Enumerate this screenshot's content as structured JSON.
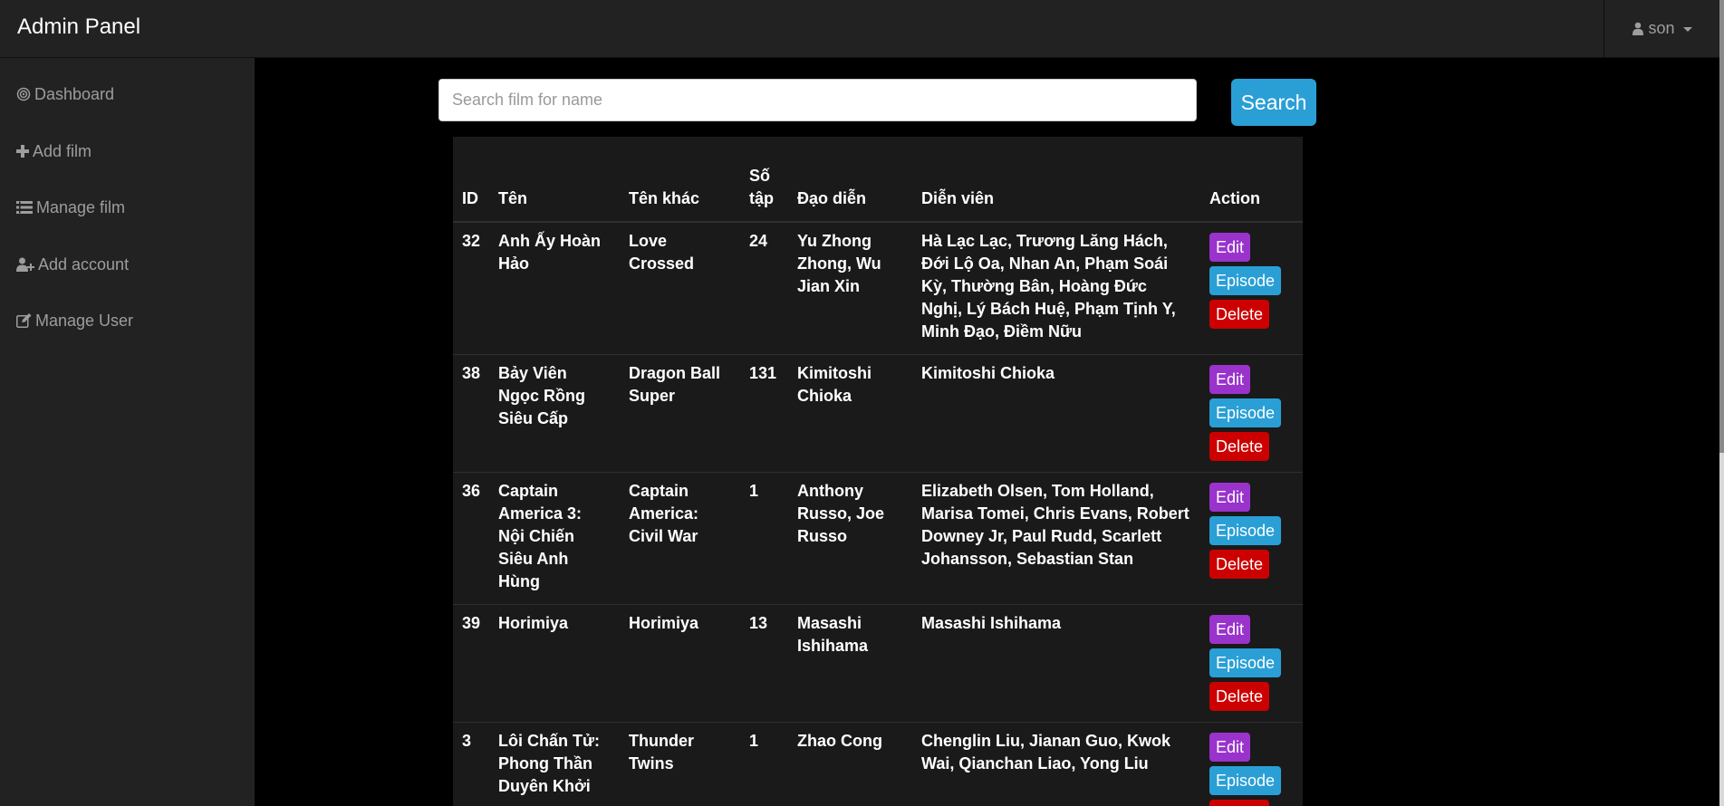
{
  "app": {
    "title": "Admin Panel",
    "user": "son"
  },
  "sidebar": {
    "items": [
      {
        "label": "Dashboard",
        "icon": "dashboard-icon"
      },
      {
        "label": "Add film",
        "icon": "plus-icon"
      },
      {
        "label": "Manage film",
        "icon": "list-icon"
      },
      {
        "label": "Add account",
        "icon": "user-add-icon"
      },
      {
        "label": "Manage User",
        "icon": "edit-icon"
      }
    ]
  },
  "search": {
    "placeholder": "Search film for name",
    "value": "",
    "button_label": "Search"
  },
  "table": {
    "headers": [
      "ID",
      "Tên",
      "Tên khác",
      "Số tập",
      "Đạo diễn",
      "Diễn viên",
      "Action"
    ],
    "actions": {
      "edit": "Edit",
      "episode": "Episode",
      "delete": "Delete"
    },
    "rows": [
      {
        "id": "32",
        "name": "Anh Ấy Hoàn Hảo",
        "other_name": "Love Crossed",
        "episodes": "24",
        "director": "Yu Zhong Zhong, Wu Jian Xin",
        "cast": "Hà Lạc Lạc, Trương Lăng Hách, Đới Lộ Oa, Nhan An, Phạm Soái Kỳ, Thường Bân, Hoàng Đức Nghị, Lý Bách Huệ, Phạm Tịnh Y, Minh Đạo, Điềm Nữu"
      },
      {
        "id": "38",
        "name": "Bảy Viên Ngọc Rồng Siêu Cấp",
        "other_name": "Dragon Ball Super",
        "episodes": "131",
        "director": "Kimitoshi Chioka",
        "cast": "Kimitoshi Chioka"
      },
      {
        "id": "36",
        "name": "Captain America 3: Nội Chiến Siêu Anh Hùng",
        "other_name": "Captain America: Civil War",
        "episodes": "1",
        "director": "Anthony Russo, Joe Russo",
        "cast": "Elizabeth Olsen, Tom Holland, Marisa Tomei, Chris Evans, Robert Downey Jr, Paul Rudd, Scarlett Johansson, Sebastian Stan"
      },
      {
        "id": "39",
        "name": "Horimiya",
        "other_name": "Horimiya",
        "episodes": "13",
        "director": "Masashi Ishihama",
        "cast": "Masashi Ishihama"
      },
      {
        "id": "3",
        "name": "Lôi Chấn Tử: Phong Thần Duyên Khởi",
        "other_name": "Thunder Twins",
        "episodes": "1",
        "director": "Zhao Cong",
        "cast": "Chenglin Liu, Jianan Guo, Kwok Wai, Qianchan Liao, Yong Liu"
      }
    ]
  },
  "colors": {
    "navbar": "#222222",
    "edit": "#9933cc",
    "episode": "#2a9fd6",
    "delete": "#cc0000",
    "search": "#2a9fd6"
  }
}
